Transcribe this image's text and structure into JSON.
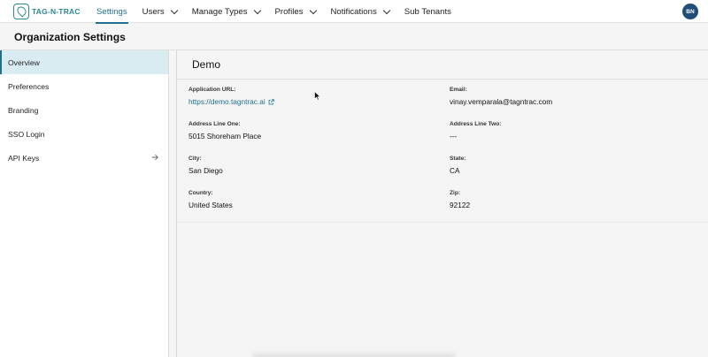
{
  "brand": {
    "name": "TAG-N-TRAC"
  },
  "nav": {
    "items": [
      {
        "label": "Settings",
        "has_dropdown": false,
        "active": true
      },
      {
        "label": "Users",
        "has_dropdown": true
      },
      {
        "label": "Manage Types",
        "has_dropdown": true
      },
      {
        "label": "Profiles",
        "has_dropdown": true
      },
      {
        "label": "Notifications",
        "has_dropdown": true
      },
      {
        "label": "Sub Tenants",
        "has_dropdown": false
      }
    ],
    "avatar_initials": "BN"
  },
  "page": {
    "title": "Organization Settings"
  },
  "sidebar": {
    "items": [
      {
        "label": "Overview",
        "active": true
      },
      {
        "label": "Preferences"
      },
      {
        "label": "Branding"
      },
      {
        "label": "SSO Login"
      },
      {
        "label": "API Keys",
        "icon": "arrow-right-icon"
      }
    ]
  },
  "org": {
    "name": "Demo",
    "fields": {
      "application_url": {
        "label": "Application URL:",
        "value": "https://demo.tagntrac.ai"
      },
      "email": {
        "label": "Email:",
        "value": "vinay.vemparala@tagntrac.com"
      },
      "address_one": {
        "label": "Address Line One:",
        "value": "5015 Shoreham Place"
      },
      "address_two": {
        "label": "Address Line Two:",
        "value": "---"
      },
      "city": {
        "label": "City:",
        "value": "San Diego"
      },
      "state": {
        "label": "State:",
        "value": "CA"
      },
      "country": {
        "label": "Country:",
        "value": "United States"
      },
      "zip": {
        "label": "Zip:",
        "value": "92122"
      }
    }
  },
  "colors": {
    "accent": "#1f6f91",
    "brand": "#2e8a8f",
    "avatar": "#1f4e79",
    "active_bg": "#d9ecf2"
  }
}
